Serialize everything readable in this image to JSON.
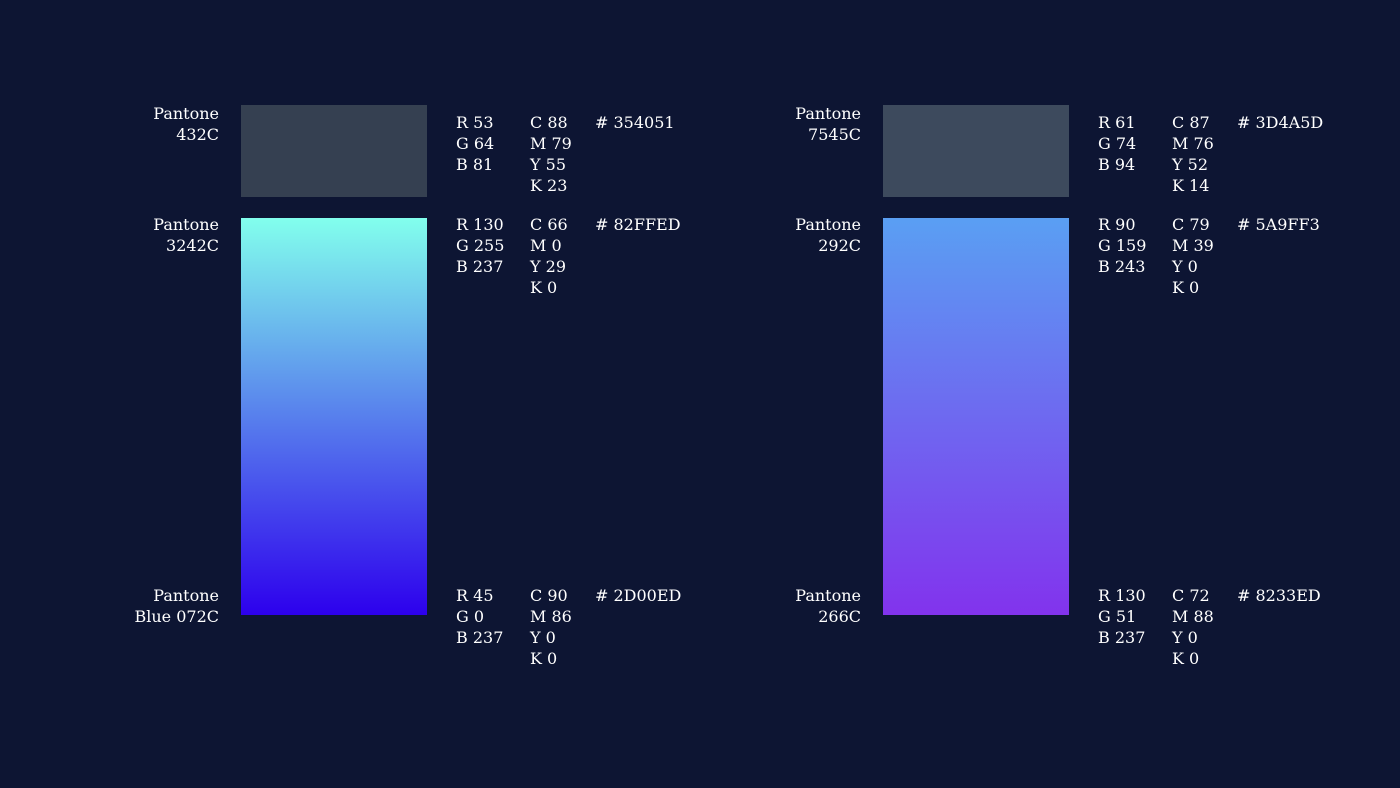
{
  "palettes": [
    {
      "solid": {
        "pantone": [
          "Pantone",
          "432C"
        ],
        "color": "#354051",
        "rgb": [
          "R 53",
          "G 64",
          "B 81"
        ],
        "cmyk": [
          "C 88",
          "M 79",
          "Y 55",
          "K 23"
        ],
        "hex": "# 354051"
      },
      "gradient_start": {
        "pantone": [
          "Pantone",
          "3242C"
        ],
        "color": "#82FFED",
        "rgb": [
          "R 130",
          "G 255",
          "B 237"
        ],
        "cmyk": [
          "C 66",
          "M 0",
          "Y 29",
          "K 0"
        ],
        "hex": "# 82FFED"
      },
      "gradient_end": {
        "pantone": [
          "Pantone",
          "Blue 072C"
        ],
        "color": "#2D00ED",
        "rgb": [
          "R 45",
          "G 0",
          "B 237"
        ],
        "cmyk": [
          "C 90",
          "M 86",
          "Y 0",
          "K 0"
        ],
        "hex": "# 2D00ED"
      }
    },
    {
      "solid": {
        "pantone": [
          "Pantone",
          "7545C"
        ],
        "color": "#3D4A5D",
        "rgb": [
          "R 61",
          "G 74",
          "B 94"
        ],
        "cmyk": [
          "C 87",
          "M 76",
          "Y 52",
          "K 14"
        ],
        "hex": "# 3D4A5D"
      },
      "gradient_start": {
        "pantone": [
          "Pantone",
          "292C"
        ],
        "color": "#5A9FF3",
        "rgb": [
          "R 90",
          "G 159",
          "B 243"
        ],
        "cmyk": [
          "C 79",
          "M 39",
          "Y 0",
          "K 0"
        ],
        "hex": "# 5A9FF3"
      },
      "gradient_end": {
        "pantone": [
          "Pantone",
          "266C"
        ],
        "color": "#8233ED",
        "rgb": [
          "R 130",
          "G 51",
          "B 237"
        ],
        "cmyk": [
          "C 72",
          "M 88",
          "Y 0",
          "K 0"
        ],
        "hex": "# 8233ED"
      }
    }
  ]
}
